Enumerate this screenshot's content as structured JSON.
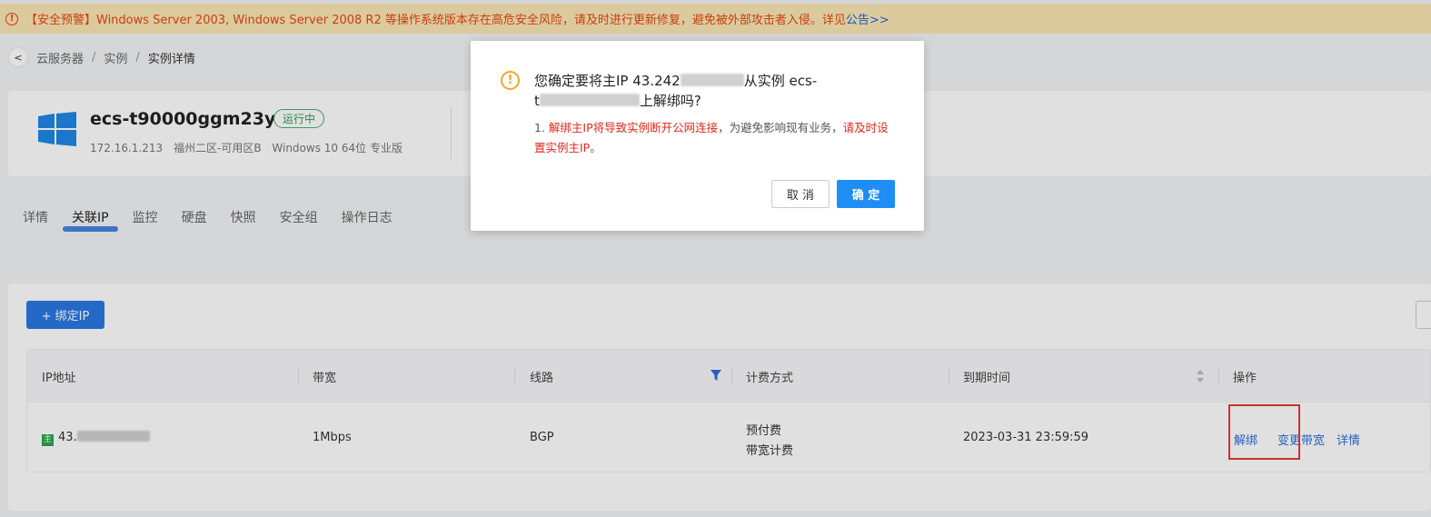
{
  "alert": {
    "text": "【安全预警】Windows Server 2003, Windows Server 2008 R2 等操作系统版本存在高危安全风险，请及时进行更新修复，避免被外部攻击者入侵。详见",
    "link": "公告>>"
  },
  "breadcrumb": {
    "back": "<",
    "items": [
      "云服务器",
      "实例",
      "实例详情"
    ],
    "sep": "/"
  },
  "instance": {
    "name": "ecs-t90000ggm23y",
    "status": "运行中",
    "ip": "172.16.1.213",
    "zone": "福州二区-可用区B",
    "os": "Windows 10 64位 专业版"
  },
  "tabs": [
    "详情",
    "关联IP",
    "监控",
    "硬盘",
    "快照",
    "安全组",
    "操作日志"
  ],
  "active_tab": "关联IP",
  "list": {
    "bind_button": "+ 绑定IP",
    "columns": [
      "IP地址",
      "带宽",
      "线路",
      "计费方式",
      "到期时间",
      "操作"
    ],
    "rows": [
      {
        "ip_prefix": "43.",
        "bandwidth": "1Mbps",
        "line": "BGP",
        "billing_1": "预付费",
        "billing_2": "带宽计费",
        "expire": "2023-03-31 23:59:59",
        "op_unbind": "解绑",
        "op_change": "变更带宽",
        "op_detail": "详情"
      }
    ]
  },
  "dialog": {
    "title_1": "您确定要将主IP 43.242",
    "title_2": "从实例 ecs-",
    "title_3": "t",
    "title_4": "上解绑吗?",
    "desc_prefix": "1. ",
    "desc_red_1": "解绑主IP将导致实例断开公网连接",
    "desc_mid": "，为避免影响现有业务，",
    "desc_red_2": "请及时设置实例主IP",
    "desc_end": "。",
    "cancel": "取 消",
    "ok": "确 定"
  },
  "colors": {
    "accent": "#2a78e4",
    "warning_bg": "#fbe6b6",
    "danger": "#e5261e",
    "status_green": "#2e9c58"
  }
}
